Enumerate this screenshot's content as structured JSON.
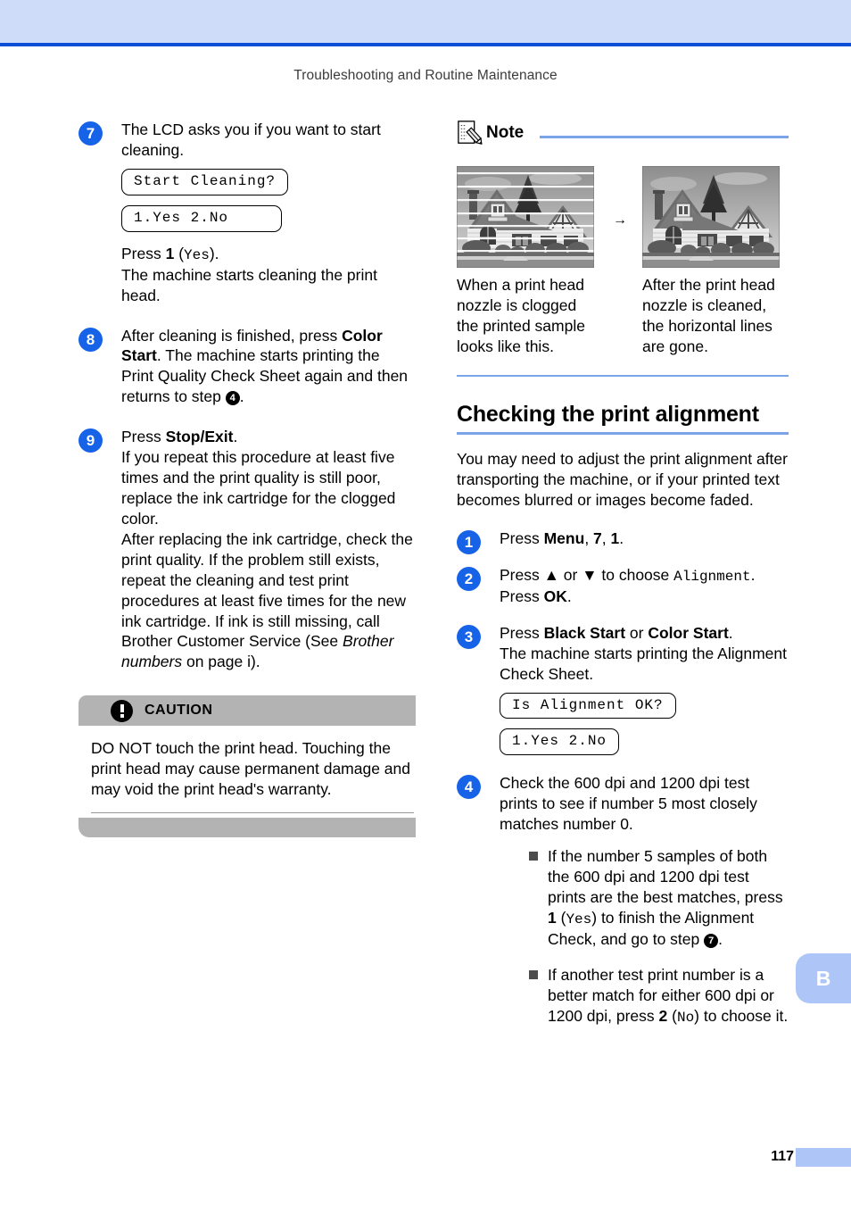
{
  "page": {
    "running_header": "Troubleshooting and Routine Maintenance",
    "number": "117",
    "tab_label": "B",
    "accent_band": "#cedcfa",
    "accent_rule": "#0a4ed6",
    "step_circle_color": "#1763e8",
    "divider_color": "#7ba3e8"
  },
  "left_column": {
    "steps": [
      {
        "num": "7",
        "line1": "The LCD asks you if you want to start",
        "line2": "cleaning.",
        "lcd1": "Start Cleaning?",
        "lcd2": "1.Yes 2.No",
        "press_prefix": "Press ",
        "press_key": "1",
        "press_open": " (",
        "press_mono": "Yes",
        "press_close": ").",
        "after": "The machine starts cleaning the print head."
      },
      {
        "num": "8",
        "lead": "After cleaning is finished, press ",
        "bold": "Color Start",
        "bold_tail": ".",
        "rest": "The machine starts printing the Print Quality Check Sheet again and then returns to step ",
        "step_ref": "4",
        "rest_tail": "."
      },
      {
        "num": "9",
        "lead": "Press ",
        "bold": "Stop/Exit",
        "bold_tail": ".",
        "para1": "If you repeat this procedure at least five times and the print quality is still poor, replace the ink cartridge for the clogged color.",
        "para2_a": "After replacing the ink cartridge, check the print quality. If the problem still exists, repeat the cleaning and test print procedures at least five times for the new ink cartridge. If ink is still missing, call Brother Customer Service (See ",
        "para2_italic": "Brother numbers",
        "para2_b": " on page i)."
      }
    ],
    "caution": {
      "icon": "exclamation-icon",
      "title": "CAUTION",
      "body": "DO NOT touch the print head. Touching the print head may cause permanent damage and may void the print head's warranty."
    }
  },
  "right_column": {
    "note": {
      "icon": "note-pencil-icon",
      "label": "Note",
      "arrow": "→",
      "figures": [
        {
          "image_name": "clogged-nozzle-sample-photo",
          "caption": "When a print head nozzle is clogged the printed sample looks like this."
        },
        {
          "image_name": "cleaned-nozzle-sample-photo",
          "caption": "After the print head nozzle is cleaned, the horizontal lines are gone."
        }
      ]
    },
    "section": {
      "title": "Checking the print alignment",
      "intro": "You may need to adjust the print alignment after transporting the machine, or if your printed text becomes blurred or images become faded.",
      "steps": [
        {
          "num": "1",
          "lead": "Press ",
          "bold": "Menu",
          "mid": ", ",
          "bold2": "7",
          "mid2": ", ",
          "bold3": "1",
          "tail": "."
        },
        {
          "num": "2",
          "lead": "Press ▲ or ▼ to choose ",
          "mono": "Alignment",
          "tail": ".",
          "line2_lead": "Press ",
          "line2_bold": "OK",
          "line2_tail": "."
        },
        {
          "num": "3",
          "lead": "Press ",
          "bold": "Black Start",
          "mid": " or ",
          "bold2": "Color Start",
          "tail": ".",
          "rest": "The machine starts printing the Alignment Check Sheet.",
          "lcd1": "Is Alignment OK?",
          "lcd2": "1.Yes 2.No"
        },
        {
          "num": "4",
          "lead": "Check the 600 dpi and 1200 dpi test prints to see if number 5 most closely matches number 0.",
          "bullets": [
            {
              "a": "If the number 5 samples of both the 600 dpi and 1200 dpi test prints are the best matches, press ",
              "key": "1",
              "open": " (",
              "mono": "Yes",
              "close": ") to ",
              "b": "finish the Alignment Check, and go to step ",
              "step_ref": "7",
              "tail": "."
            },
            {
              "a": "If another test print number is a better match for either 600 dpi or 1200 dpi, press ",
              "key": "2",
              "open": " (",
              "mono": "No",
              "close": ") to choose it.",
              "b": "",
              "step_ref": "",
              "tail": ""
            }
          ]
        }
      ]
    }
  }
}
